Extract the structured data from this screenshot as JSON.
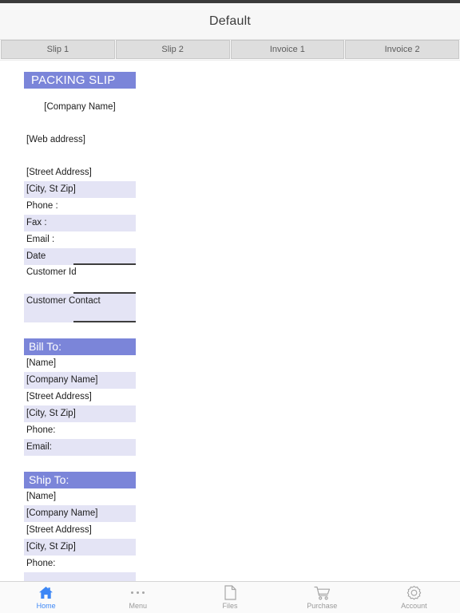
{
  "window": {
    "title": "Default"
  },
  "tabs": [
    {
      "label": "Slip 1",
      "name": "tab-slip-1"
    },
    {
      "label": "Slip 2",
      "name": "tab-slip-2"
    },
    {
      "label": "Invoice 1",
      "name": "tab-invoice-1"
    },
    {
      "label": "Invoice 2",
      "name": "tab-invoice-2"
    }
  ],
  "colors": {
    "section_header_bg": "#7b85d9",
    "section_header_text": "#ffffff",
    "row_shaded_bg": "#e4e4f5",
    "row_plain_bg": "#ffffff",
    "rule": "#3d3d3d",
    "active_nav": "#3d87f5",
    "nav_label": "#9a9a9a",
    "tab_bg": "#dedede",
    "title_bar_bg": "#f7f7f7"
  },
  "document": {
    "heading": "PACKING SLIP",
    "company_name": "[Company Name]",
    "web_address": "[Web address]",
    "sender": {
      "street_address": "[Street Address]",
      "city_state_zip": "[City, St  Zip]",
      "phone": "Phone :",
      "fax": "Fax :",
      "email": "Email :",
      "date": "Date",
      "customer_id": "Customer Id",
      "customer_contact": "Customer Contact"
    },
    "bill_to": {
      "heading": "Bill To:",
      "name": "[Name]",
      "company_name": "[Company Name]",
      "street_address": "[Street Address]",
      "city_state_zip": "[City, St  Zip]",
      "phone": "Phone:",
      "email": "Email:"
    },
    "ship_to": {
      "heading": "Ship To:",
      "name": "[Name]",
      "company_name": "[Company Name]",
      "street_address": "[Street Address]",
      "city_state_zip": "[City, St  Zip]",
      "phone": "Phone:"
    }
  },
  "bottom_nav": [
    {
      "label": "Home",
      "icon": "home-icon",
      "active": true
    },
    {
      "label": "Menu",
      "icon": "menu-dots-icon",
      "active": false
    },
    {
      "label": "Files",
      "icon": "document-icon",
      "active": false
    },
    {
      "label": "Purchase",
      "icon": "cart-icon",
      "active": false
    },
    {
      "label": "Account",
      "icon": "gear-icon",
      "active": false
    }
  ]
}
